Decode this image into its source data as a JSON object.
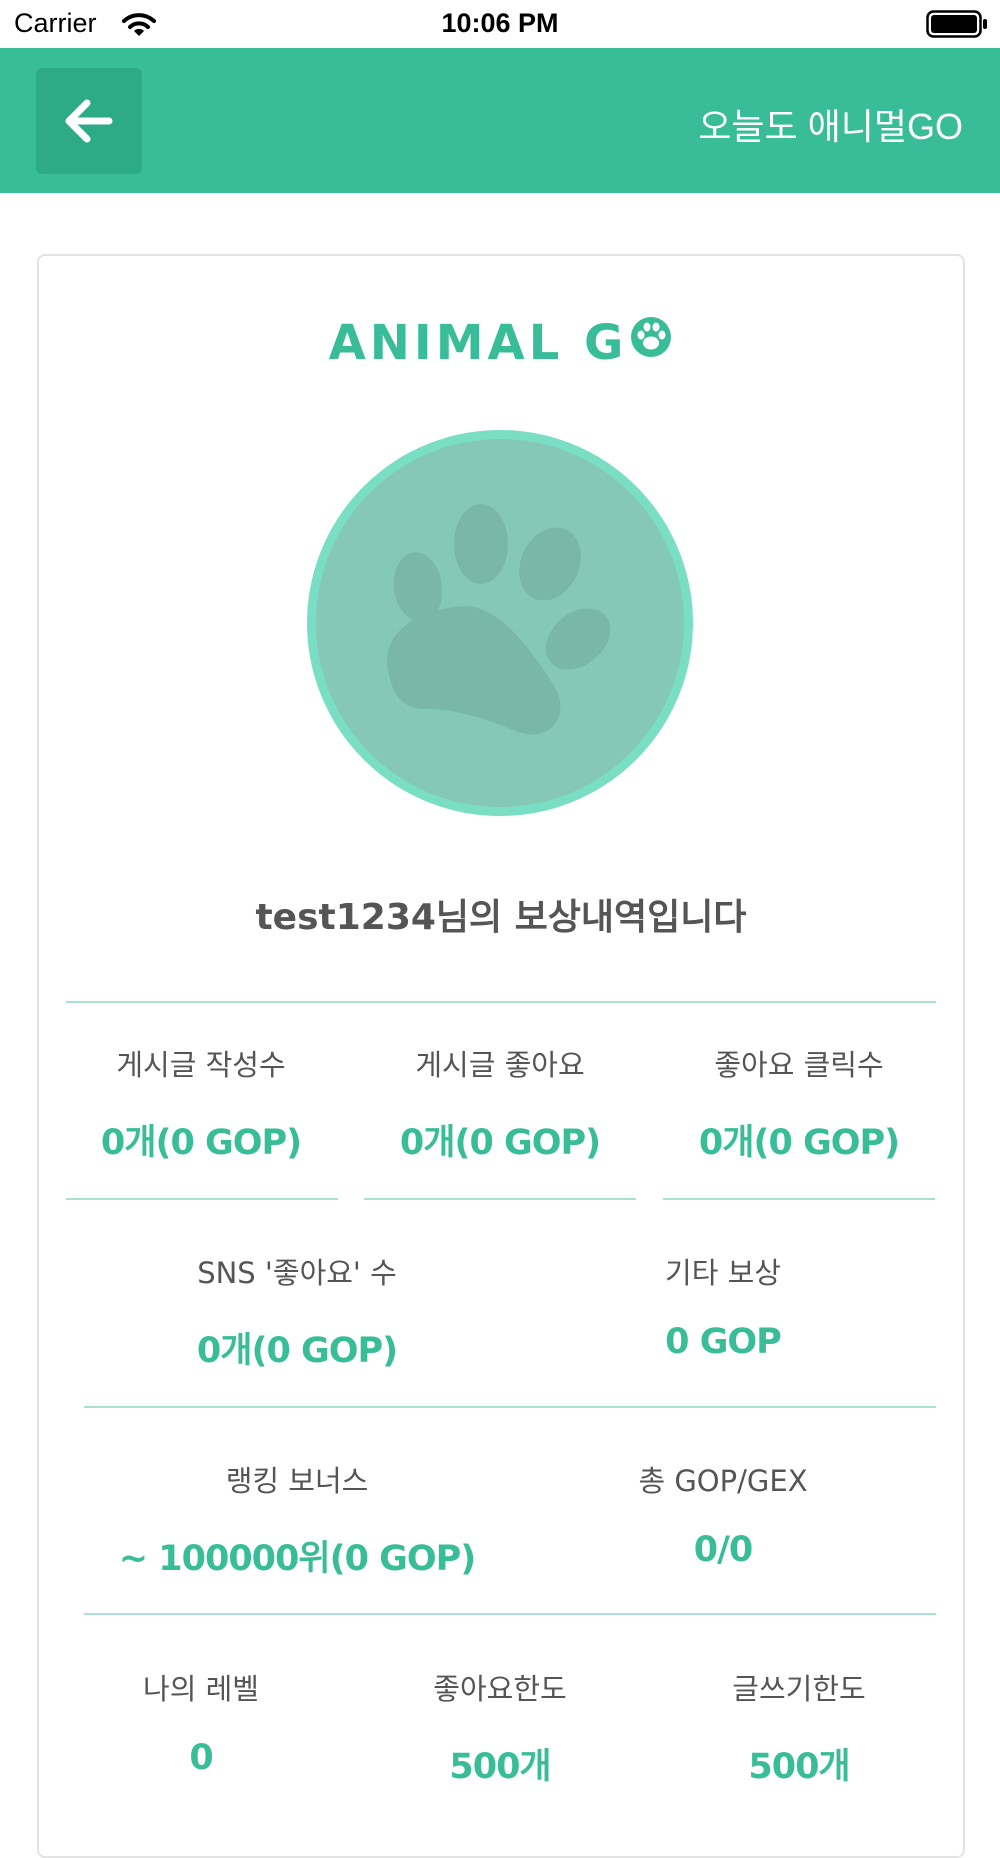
{
  "status_bar": {
    "carrier": "Carrier",
    "time": "10:06 PM"
  },
  "header": {
    "title": "오늘도 애니멀GO"
  },
  "logo": {
    "text": "ANIMAL G"
  },
  "profile": {
    "headline": "test1234님의 보상내역입니다"
  },
  "stats_row1": [
    {
      "label": "게시글 작성수",
      "value": "0개(0 GOP)"
    },
    {
      "label": "게시글 좋아요",
      "value": "0개(0 GOP)"
    },
    {
      "label": "좋아요 클릭수",
      "value": "0개(0 GOP)"
    }
  ],
  "stats_row2": [
    {
      "label": "SNS '좋아요' 수",
      "value": "0개(0 GOP)"
    },
    {
      "label": "기타 보상",
      "value": "0 GOP"
    }
  ],
  "stats_row3": [
    {
      "label": "랭킹 보너스",
      "value": "~ 100000위(0 GOP)"
    },
    {
      "label": "총 GOP/GEX",
      "value": "0/0"
    }
  ],
  "stats_row4": [
    {
      "label": "나의 레벨",
      "value": "0"
    },
    {
      "label": "좋아요한도",
      "value": "500개"
    },
    {
      "label": "글쓰기한도",
      "value": "500개"
    }
  ],
  "colors": {
    "accent": "#39bd98",
    "accent_dark": "#2dab87",
    "divider": "#a8e2d3",
    "avatar_bg": "#86c8b8",
    "avatar_ring": "#79dec4"
  },
  "icons": [
    "wifi-icon",
    "battery-icon",
    "back-arrow-icon",
    "paw-icon",
    "avatar-paw-icon"
  ]
}
